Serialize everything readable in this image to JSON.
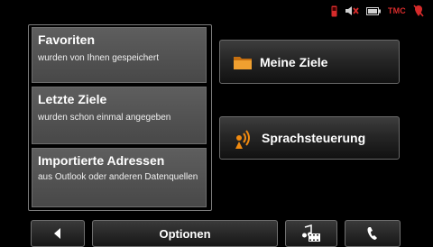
{
  "status_bar": {
    "icons": [
      "phone-icon",
      "mute-icon",
      "battery-icon",
      "gps-off-icon"
    ],
    "tmc_label": "TMC",
    "colors": {
      "alert": "#d62b2b",
      "battery": "#cfcfcf"
    }
  },
  "popup": {
    "items": [
      {
        "title": "Favoriten",
        "subtitle": "wurden von Ihnen gespeichert"
      },
      {
        "title": "Letzte Ziele",
        "subtitle": "wurden schon einmal angegeben"
      },
      {
        "title": "Importierte Adressen",
        "subtitle": "aus Outlook oder anderen Datenquellen"
      }
    ]
  },
  "main_buttons": {
    "my_destinations": {
      "label": "Meine Ziele",
      "icon": "folder-icon"
    },
    "voice_control": {
      "label": "Sprachsteuerung",
      "icon": "voice-icon"
    }
  },
  "bottom_bar": {
    "back_icon": "back-arrow-icon",
    "options_label": "Optionen",
    "media_icon": "media-icon",
    "phone_icon": "phone-handset-icon"
  },
  "colors": {
    "folder": "#e8891c",
    "voice": "#f08a10",
    "background": "#000000"
  }
}
